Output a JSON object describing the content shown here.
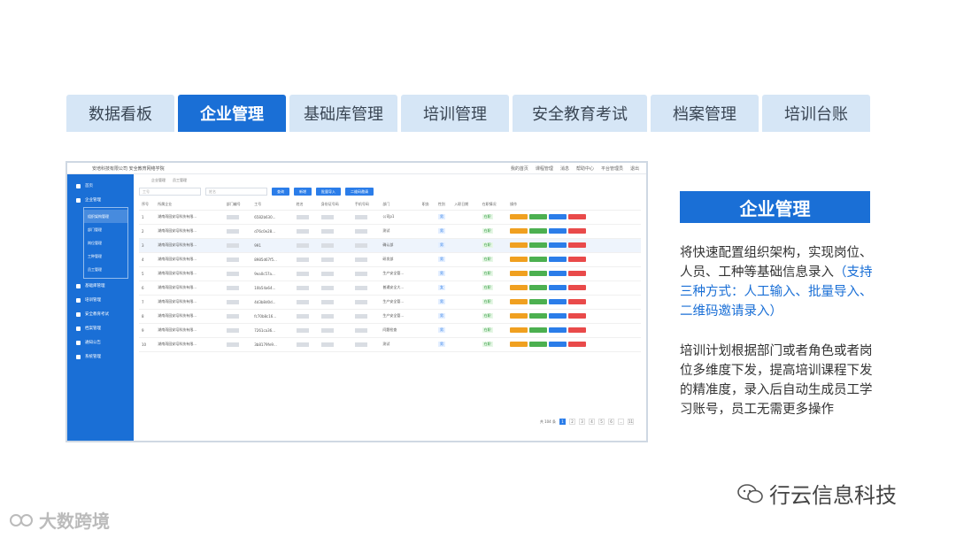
{
  "tabs": [
    {
      "label": "数据看板",
      "active": false
    },
    {
      "label": "企业管理",
      "active": true
    },
    {
      "label": "基础库管理",
      "active": false
    },
    {
      "label": "培训管理",
      "active": false
    },
    {
      "label": "安全教育考试",
      "active": false
    },
    {
      "label": "档案管理",
      "active": false
    },
    {
      "label": "培训台账",
      "active": false
    }
  ],
  "mock": {
    "org_name": "安培科技有限公司 安全教育网络学院",
    "top_nav": [
      "我的首页",
      "课程管理",
      "消息",
      "帮助中心",
      "平台管理员",
      "退出"
    ],
    "sidebar": {
      "home": "首页",
      "enterprise": "企业管理",
      "sub": [
        "组织架构管理",
        "部门管理",
        "岗位管理",
        "工种管理",
        "员工管理"
      ],
      "others": [
        "基础库管理",
        "培训管理",
        "安全教育考试",
        "档案管理",
        "通知公告",
        "系统管理"
      ]
    },
    "crumbs": [
      "企业管理",
      "员工管理"
    ],
    "filters": {
      "input1": "工号",
      "input2": "姓名",
      "buttons": [
        "查询",
        "新增",
        "批量导入",
        "二维码邀请"
      ]
    },
    "columns": [
      "序号",
      "所属企业",
      "部门编号",
      "工号",
      "姓名",
      "身份证号码",
      "手机号码",
      "部门",
      "职务",
      "性别",
      "入职日期",
      "在职情况",
      "操作"
    ],
    "rows": [
      {
        "no": "1",
        "company": "湖南雨园安培科技有限...",
        "job": "6582b630...",
        "dept": "公司p1",
        "sex": "男",
        "status": "在职"
      },
      {
        "no": "2",
        "company": "湖南雨园安培科技有限...",
        "job": "d76c0e28...",
        "dept": "测试",
        "sex": "男",
        "status": "在职"
      },
      {
        "no": "3",
        "company": "湖南雨园安培科技有限...",
        "job": "991",
        "dept": "确认部",
        "sex": "男",
        "status": "在职"
      },
      {
        "no": "4",
        "company": "湖南雨园安培科技有限...",
        "job": "8985d67f5...",
        "dept": "研发部",
        "sex": "男",
        "status": "在职"
      },
      {
        "no": "5",
        "company": "湖南雨园安培科技有限...",
        "job": "9ea0c57a...",
        "dept": "生产安全管...",
        "sex": "男",
        "status": "在职"
      },
      {
        "no": "6",
        "company": "湖南雨园安培科技有限...",
        "job": "10b54a64...",
        "dept": "普通安全大...",
        "sex": "女",
        "status": "在职"
      },
      {
        "no": "7",
        "company": "湖南雨园安培科技有限...",
        "job": "4d3b8d0d...",
        "dept": "生产安全管...",
        "sex": "男",
        "status": "在职"
      },
      {
        "no": "8",
        "company": "湖南雨园安培科技有限...",
        "job": "fc70b8c16...",
        "dept": "生产安全管...",
        "sex": "男",
        "status": "在职"
      },
      {
        "no": "9",
        "company": "湖南雨园安培科技有限...",
        "job": "7261ca36...",
        "dept": "问题检查",
        "sex": "男",
        "status": "在职"
      },
      {
        "no": "10",
        "company": "湖南雨园安培科技有限...",
        "job": "3b8179fe9...",
        "dept": "测试",
        "sex": "男",
        "status": "在职"
      }
    ],
    "action_colors": [
      "#f0a020",
      "#4cb050",
      "#2b7de9",
      "#e94a4a"
    ],
    "pager": {
      "total": "共 104 条",
      "pages": [
        "1",
        "2",
        "3",
        "4",
        "5",
        "6",
        "...",
        "11"
      ]
    }
  },
  "panel": {
    "title": "企业管理",
    "p1_a": "将快速配置组织架构，实现岗位、人员、工种等基础信息录入",
    "p1_b": "（支持三种方式：人工输入、批量导入、二维码邀请录入）",
    "p2": "培训计划根据部门或者角色或者岗位多维度下发，提高培训课程下发的精准度，录入后自动生成员工学习账号，员工无需更多操作"
  },
  "watermark": {
    "right": "行云信息科技",
    "left": "大数跨境"
  }
}
